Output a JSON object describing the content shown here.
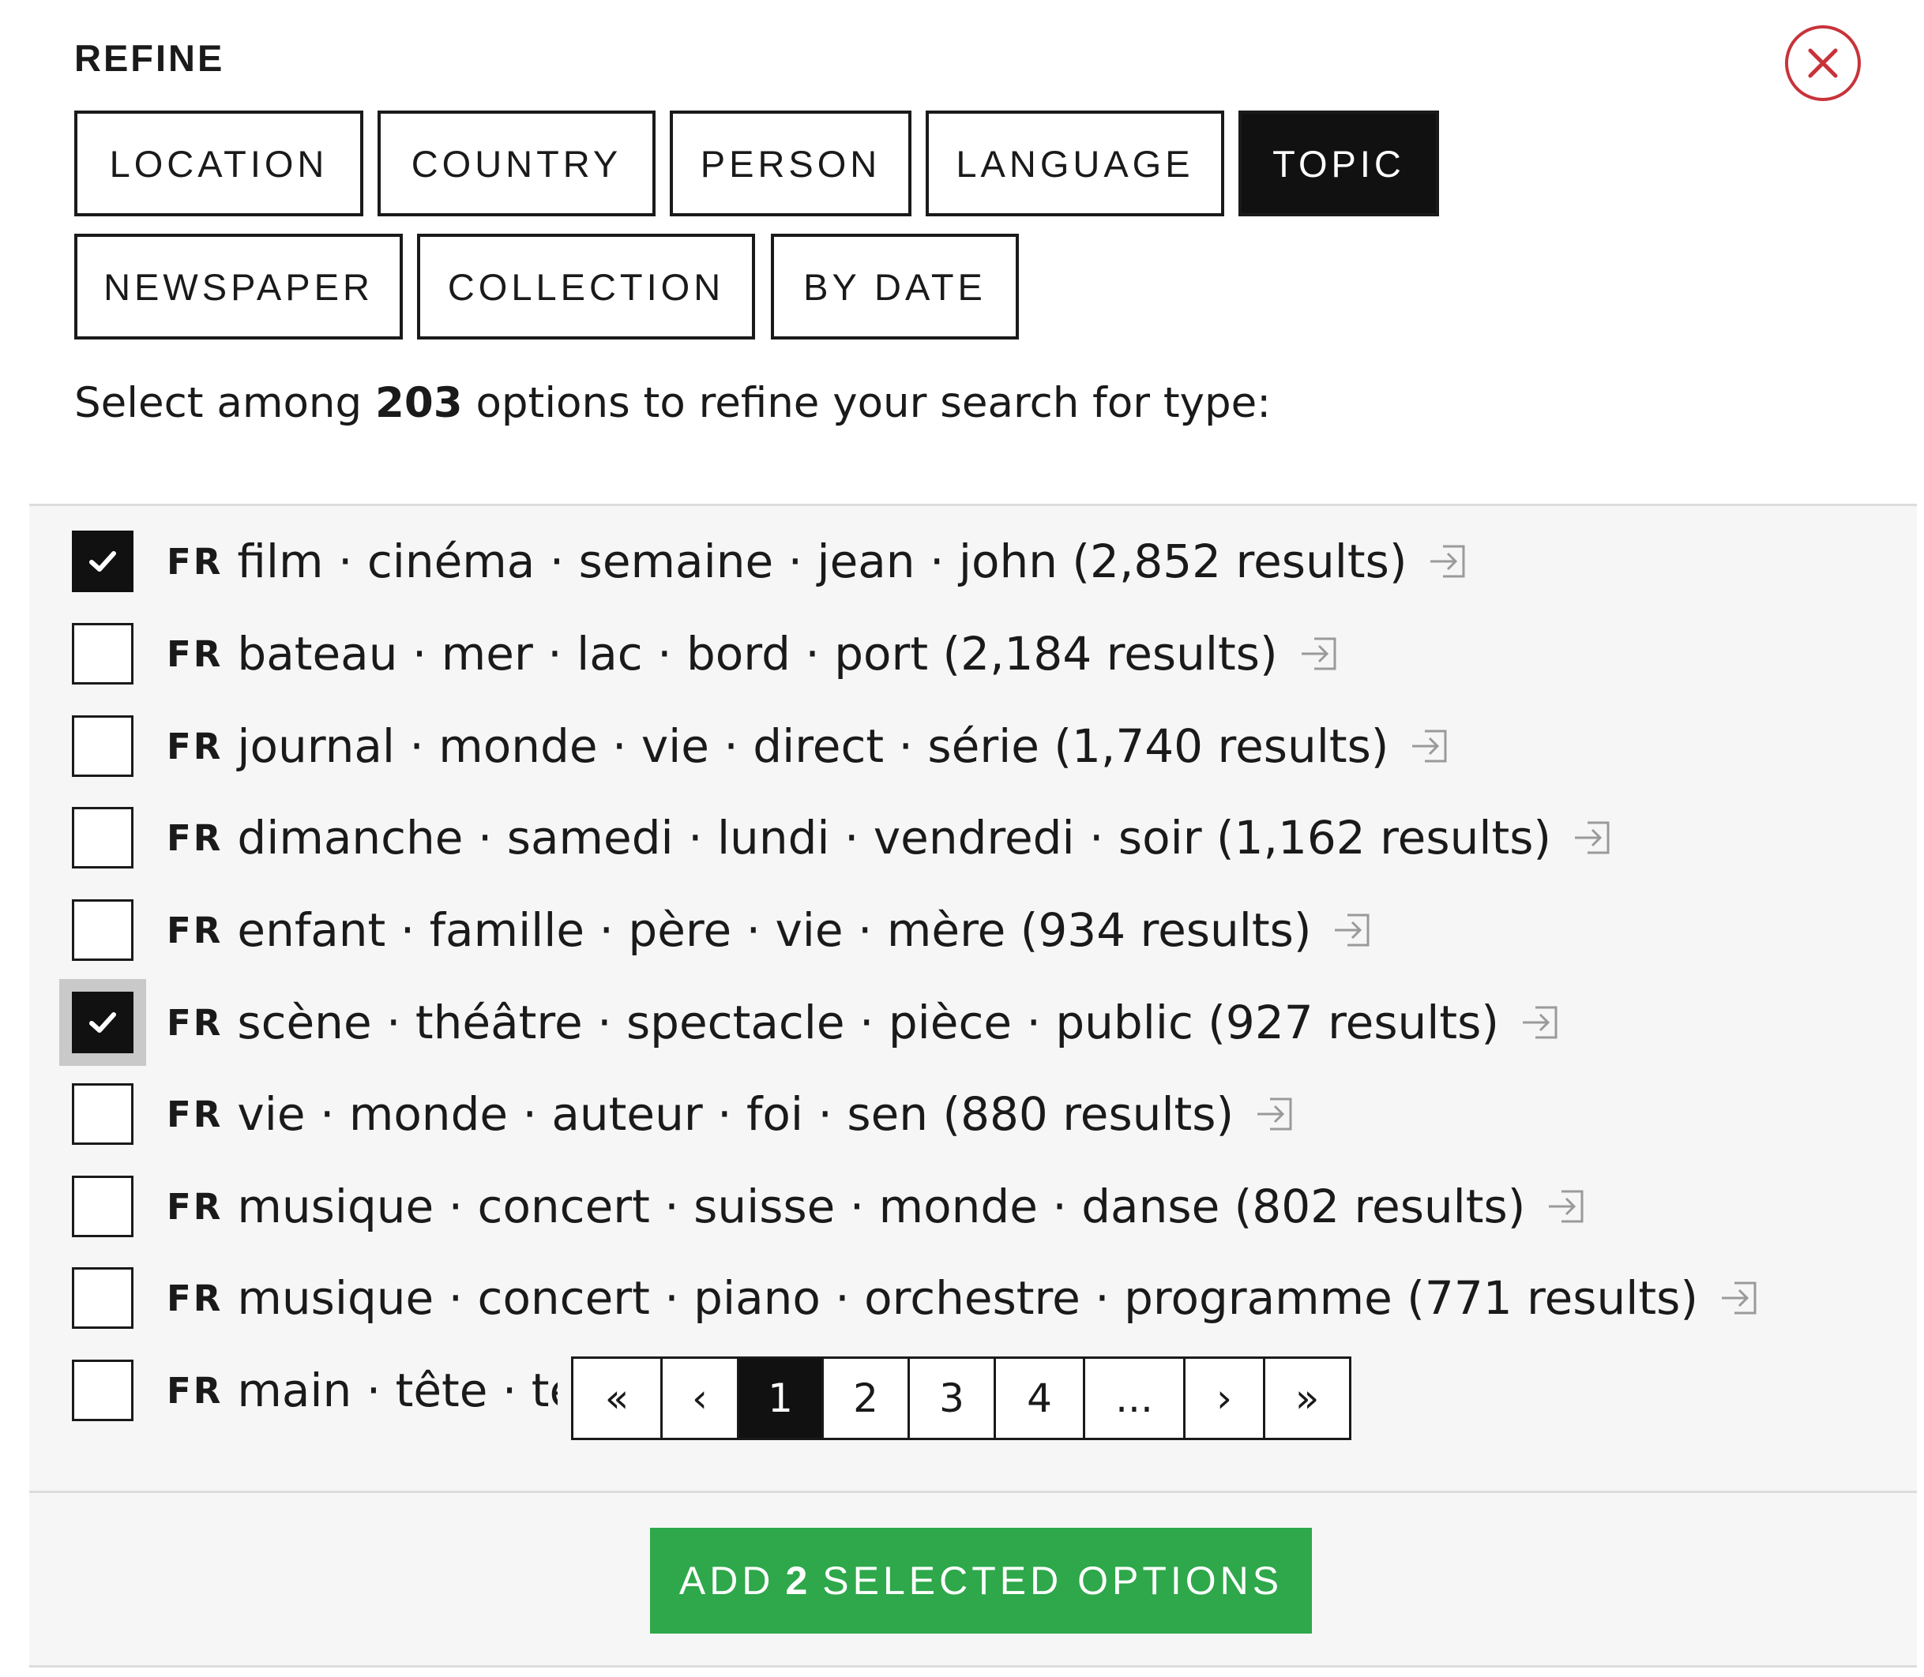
{
  "header": {
    "title": "REFINE"
  },
  "tabs": [
    {
      "label": "LOCATION",
      "active": false
    },
    {
      "label": "COUNTRY",
      "active": false
    },
    {
      "label": "PERSON",
      "active": false
    },
    {
      "label": "LANGUAGE",
      "active": false
    },
    {
      "label": "TOPIC",
      "active": true
    },
    {
      "label": "NEWSPAPER",
      "active": false
    },
    {
      "label": "COLLECTION",
      "active": false
    },
    {
      "label": "BY DATE",
      "active": false
    }
  ],
  "summary": {
    "prefix": "Select among",
    "count": "203",
    "suffix": "options to refine your search for type:"
  },
  "options": [
    {
      "lang": "FR",
      "text": "film · cinéma · semaine · jean · john (2,852 results)",
      "checked": true,
      "focused": false
    },
    {
      "lang": "FR",
      "text": "bateau · mer · lac · bord · port (2,184 results)",
      "checked": false,
      "focused": false
    },
    {
      "lang": "FR",
      "text": "journal · monde · vie · direct · série (1,740 results)",
      "checked": false,
      "focused": false
    },
    {
      "lang": "FR",
      "text": "dimanche · samedi · lundi · vendredi · soir (1,162 results)",
      "checked": false,
      "focused": false
    },
    {
      "lang": "FR",
      "text": "enfant · famille · père · vie · mère (934 results)",
      "checked": false,
      "focused": false
    },
    {
      "lang": "FR",
      "text": "scène · théâtre · spectacle · pièce · public (927 results)",
      "checked": true,
      "focused": true
    },
    {
      "lang": "FR",
      "text": "vie · monde · auteur · foi · sen (880 results)",
      "checked": false,
      "focused": false
    },
    {
      "lang": "FR",
      "text": "musique · concert · suisse · monde · danse (802 results)",
      "checked": false,
      "focused": false
    },
    {
      "lang": "FR",
      "text": "musique · concert · piano · orchestre · programme (771 results)",
      "checked": false,
      "focused": false
    },
    {
      "lang": "FR",
      "text": "main · tête · te",
      "checked": false,
      "focused": false
    }
  ],
  "pagination": {
    "first": "«",
    "prev": "‹",
    "pages": [
      "1",
      "2",
      "3",
      "4"
    ],
    "current": "1",
    "ellipsis": "...",
    "next": "›",
    "last": "»"
  },
  "footer": {
    "button_prefix": "ADD",
    "button_count": "2",
    "button_suffix": "SELECTED OPTIONS"
  },
  "colors": {
    "accent_green": "#2ea84a",
    "close_red": "#c8333a",
    "active_tab": "#111111"
  }
}
